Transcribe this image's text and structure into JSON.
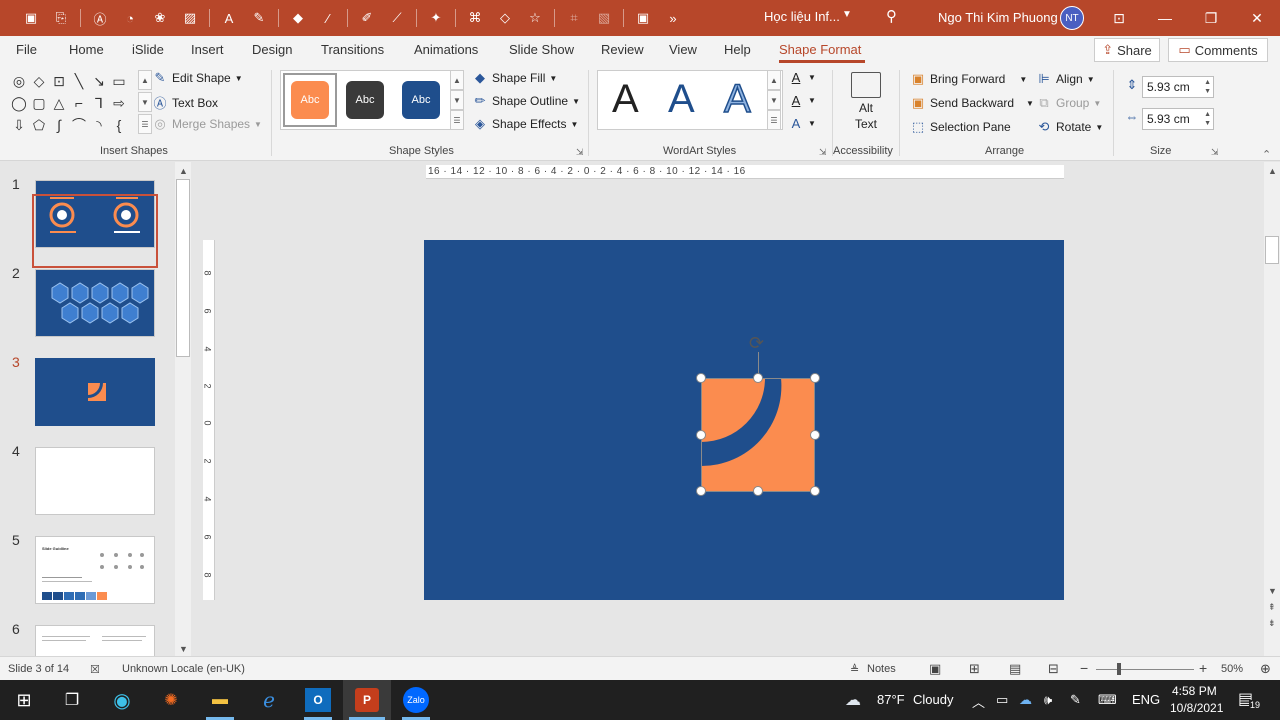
{
  "app": {
    "title": "Học liệu Inf...",
    "user_name": "Ngo Thi Kim Phuong",
    "user_initials": "NT",
    "accent_color": "#b7472a"
  },
  "qat_icons": [
    "autosave-icon",
    "open-icon",
    "text-box-icon",
    "shapes-icon",
    "effects-icon",
    "picture-icon",
    "font-color-icon",
    "highlighter-icon",
    "fill-icon",
    "eyedropper-icon",
    "pen-icon",
    "format-painter-icon",
    "magic-icon",
    "arrange-icon",
    "lasso-icon",
    "star-icon",
    "crop-icon",
    "image-icon",
    "record-icon",
    "more-icon"
  ],
  "tabs": [
    "File",
    "Home",
    "iSlide",
    "Insert",
    "Design",
    "Transitions",
    "Animations",
    "Slide Show",
    "Review",
    "View",
    "Help",
    "Shape Format"
  ],
  "active_tab": "Shape Format",
  "share_label": "Share",
  "comments_label": "Comments",
  "ribbon": {
    "insert_shapes": {
      "label": "Insert Shapes",
      "edit_shape": "Edit Shape",
      "text_box": "Text Box",
      "merge_shapes": "Merge Shapes"
    },
    "shape_styles": {
      "label": "Shape Styles",
      "swatch_text": "Abc",
      "swatches": [
        "#fb8c4f",
        "#3a3a3a",
        "#1f4e8c"
      ],
      "shape_fill": "Shape Fill",
      "shape_outline": "Shape Outline",
      "shape_effects": "Shape Effects"
    },
    "wordart": {
      "label": "WordArt Styles",
      "letter": "A"
    },
    "accessibility": {
      "label": "Accessibility",
      "alt_text_line1": "Alt",
      "alt_text_line2": "Text"
    },
    "arrange": {
      "label": "Arrange",
      "bring_forward": "Bring Forward",
      "send_backward": "Send Backward",
      "selection_pane": "Selection Pane",
      "align": "Align",
      "group": "Group",
      "rotate": "Rotate"
    },
    "size": {
      "label": "Size",
      "height": "5.93 cm",
      "width": "5.93 cm"
    }
  },
  "slides": {
    "numbers": [
      "1",
      "2",
      "3",
      "4",
      "5",
      "6"
    ],
    "selected": "3",
    "slide5_title": "Slide Guidline"
  },
  "ruler": {
    "horizontal": "16 · 14 · 12 · 10 · 8 · 6 · 4 · 2 · 0 · 2 · 4 · 6 · 8 · 10 · 12 · 14 · 16",
    "vertical": [
      "8",
      "6",
      "4",
      "2",
      "0",
      "2",
      "4",
      "6",
      "8"
    ]
  },
  "slide_colors": {
    "background": "#1f4e8c",
    "shape_fill": "#fb8c4f"
  },
  "status": {
    "slide_info": "Slide 3 of 14",
    "locale": "Unknown Locale (en-UK)",
    "notes": "Notes",
    "zoom": "50%"
  },
  "taskbar": {
    "weather_temp": "87°F",
    "weather_text": "Cloudy",
    "language": "ENG",
    "time": "4:58 PM",
    "date": "10/8/2021",
    "notification_count": "19"
  }
}
